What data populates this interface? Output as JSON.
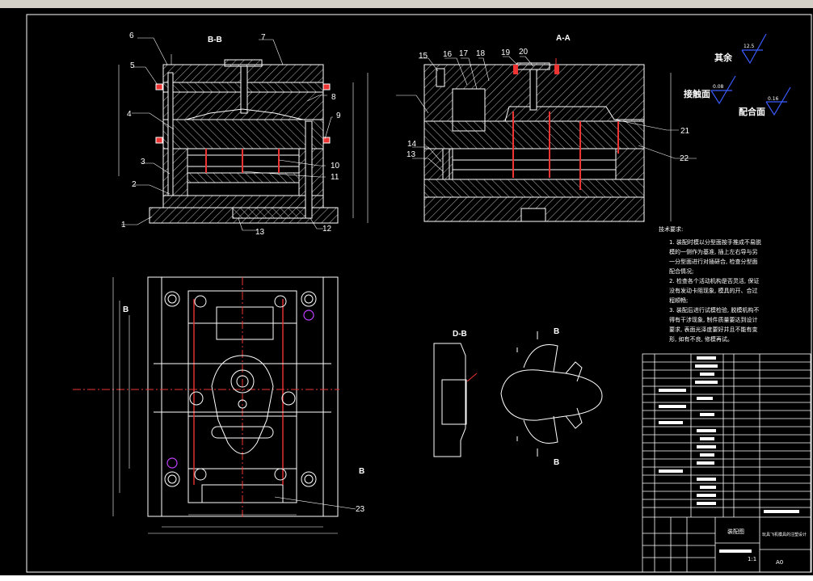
{
  "drawing": {
    "section_bb_top": "B-B",
    "section_aa": "A-A",
    "section_db": "D-B",
    "part_callouts_left": [
      "6",
      "5",
      "7",
      "8",
      "4",
      "9",
      "3",
      "10",
      "11",
      "2",
      "1",
      "13",
      "12"
    ],
    "part_callouts_right": [
      "15",
      "16",
      "17",
      "18",
      "19",
      "20",
      "14",
      "13",
      "21",
      "22"
    ],
    "callout_23": "23",
    "plan_view_marks": [
      "B",
      "B"
    ],
    "product_view_marks": [
      "B",
      "B"
    ],
    "roughness": {
      "rest_label": "其余",
      "rest_value": "12.5",
      "contact_label": "接触面",
      "contact_value": "0.08",
      "fit_label": "配合面",
      "fit_value": "0.16"
    },
    "tech_requirements": {
      "title": "技术要求:",
      "lines": [
        "1. 装配时模以分型面按手推成不易脱",
        "模的一侧作为基准, 插上左右导与另",
        "一分型面进行对插研合, 检查分型面",
        "配合情况;",
        "2. 检查各个活动机构是否灵活, 保证",
        "没有发动卡阻现象, 模具的开、合过",
        "程顺畅;",
        "3. 装配后进行试模检验, 脱模机构不",
        "得有干涉现象, 制件质量要达到设计",
        "要求, 表面光泽度要好并且不能有变",
        "形, 如有不良, 修模再试。"
      ]
    },
    "title_block": {
      "drawing_name": "装配图",
      "project": "玩具飞机模具的注塑设计",
      "scale": "1:1",
      "sheet": "A0"
    }
  }
}
